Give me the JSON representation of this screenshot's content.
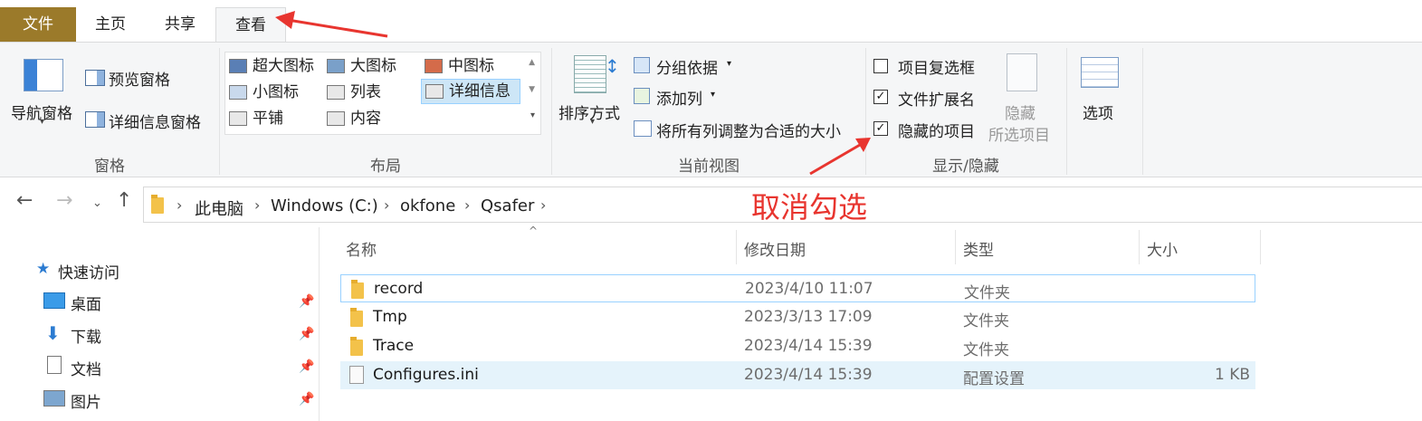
{
  "tabs": {
    "file": "文件",
    "home": "主页",
    "share": "共享",
    "view": "查看"
  },
  "ribbon": {
    "panes": {
      "nav_pane": "导航窗格",
      "preview_pane": "预览窗格",
      "details_pane": "详细信息窗格",
      "group_label": "窗格"
    },
    "layout": {
      "extra_large": "超大图标",
      "large": "大图标",
      "medium": "中图标",
      "small": "小图标",
      "list": "列表",
      "details": "详细信息",
      "tiles": "平铺",
      "content": "内容",
      "group_label": "布局"
    },
    "current_view": {
      "sort_by": "排序方式",
      "group_by": "分组依据",
      "add_columns": "添加列",
      "size_all_columns": "将所有列调整为合适的大小",
      "group_label": "当前视图"
    },
    "show_hide": {
      "item_checkboxes": "项目复选框",
      "item_checkboxes_checked": false,
      "file_extensions": "文件扩展名",
      "file_extensions_checked": true,
      "hidden_items": "隐藏的项目",
      "hidden_items_checked": true,
      "hide_selected_line1": "隐藏",
      "hide_selected_line2": "所选项目",
      "group_label": "显示/隐藏"
    },
    "options": "选项"
  },
  "address": {
    "crumbs": [
      "此电脑",
      "Windows (C:)",
      "okfone",
      "Qsafer"
    ]
  },
  "nav_pane": {
    "quick_access": "快速访问",
    "items": [
      "桌面",
      "下载",
      "文档",
      "图片"
    ]
  },
  "columns": {
    "name": "名称",
    "modified": "修改日期",
    "type": "类型",
    "size": "大小"
  },
  "files": [
    {
      "name": "record",
      "modified": "2023/4/10 11:07",
      "type": "文件夹",
      "size": ""
    },
    {
      "name": "Tmp",
      "modified": "2023/3/13 17:09",
      "type": "文件夹",
      "size": ""
    },
    {
      "name": "Trace",
      "modified": "2023/4/14 15:39",
      "type": "文件夹",
      "size": ""
    },
    {
      "name": "Configures.ini",
      "modified": "2023/4/14 15:39",
      "type": "配置设置",
      "size": "1 KB"
    }
  ],
  "annotation": {
    "text": "取消勾选",
    "color": "#e8352f"
  },
  "colors": {
    "file_tab": "#9b7a2a",
    "selection": "#cde6f7"
  }
}
